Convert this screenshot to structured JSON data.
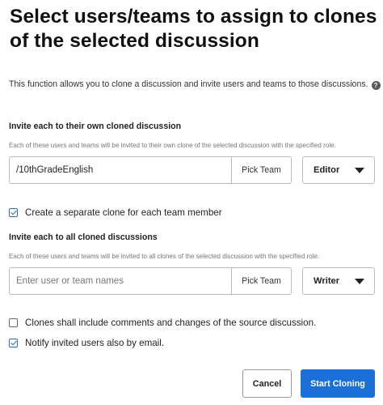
{
  "dialog": {
    "title": "Select users/teams to assign to clones of the selected discussion",
    "intro": "This function allows you to clone a discussion and invite users and teams to those discussions.",
    "help_icon": "?"
  },
  "own_clone": {
    "heading": "Invite each to their own cloned discussion",
    "description": "Each of these users and teams will be invited to their own clone of the selected discussion with the specified role.",
    "input_value": "/10thGradeEnglish",
    "pick_team_label": "Pick Team",
    "role": "Editor",
    "separate_clone_label": "Create a separate clone for each team member",
    "separate_clone_checked": true
  },
  "all_clones": {
    "heading": "Invite each to all cloned discussions",
    "description": "Each of these users and teams will be invited to all clones of the selected discussion with the specified role.",
    "input_placeholder": "Enter user or team names",
    "pick_team_label": "Pick Team",
    "role": "Writer"
  },
  "options": {
    "include_comments_label": "Clones shall include comments and changes of the source discussion.",
    "include_comments_checked": false,
    "notify_email_label": "Notify invited users also by email.",
    "notify_email_checked": true
  },
  "actions": {
    "cancel_label": "Cancel",
    "start_label": "Start Cloning"
  },
  "colors": {
    "primary": "#1a6fd8",
    "checkbox_check": "#2d6bd3"
  }
}
